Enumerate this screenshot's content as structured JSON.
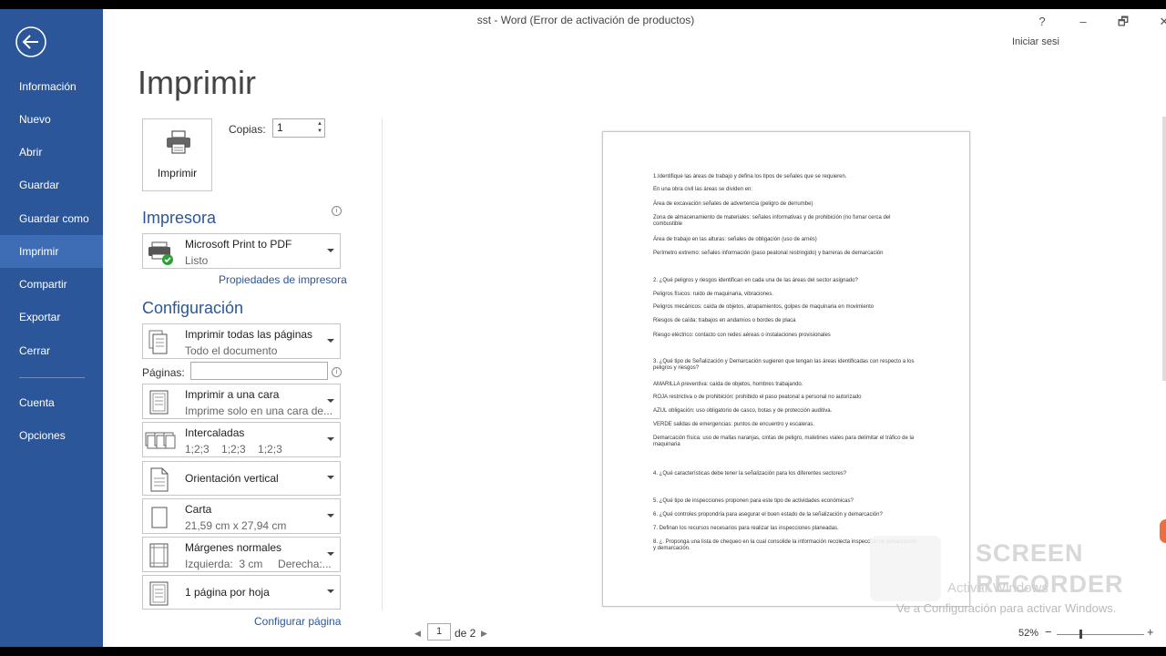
{
  "window": {
    "title": "sst - Word (Error de activación de productos)",
    "help": "?",
    "minimize": "–",
    "restore": "🗗",
    "close": "✕",
    "signin": "Iniciar sesi"
  },
  "sidebar": {
    "items": [
      {
        "label": "Información"
      },
      {
        "label": "Nuevo"
      },
      {
        "label": "Abrir"
      },
      {
        "label": "Guardar"
      },
      {
        "label": "Guardar como"
      },
      {
        "label": "Imprimir",
        "active": true
      },
      {
        "label": "Compartir"
      },
      {
        "label": "Exportar"
      },
      {
        "label": "Cerrar"
      },
      {
        "label": "Cuenta"
      },
      {
        "label": "Opciones"
      }
    ]
  },
  "print": {
    "page_title": "Imprimir",
    "print_button": "Imprimir",
    "copies_label": "Copias:",
    "copies_value": "1",
    "printer_heading": "Impresora",
    "printer_name": "Microsoft Print to PDF",
    "printer_status": "Listo",
    "printer_properties": "Propiedades de impresora",
    "config_heading": "Configuración",
    "pages_label": "Páginas:",
    "pages_value": "",
    "settings": [
      {
        "main": "Imprimir todas las páginas",
        "sub": "Todo el documento"
      },
      {
        "main": "Imprimir a una cara",
        "sub": "Imprime solo en una cara de..."
      },
      {
        "main": "Intercaladas",
        "sub": "1;2;3    1;2;3    1;2;3"
      },
      {
        "main": "Orientación vertical",
        "sub": ""
      },
      {
        "main": "Carta",
        "sub": "21,59 cm x 27,94 cm"
      },
      {
        "main": "Márgenes normales",
        "sub": "Izquierda:  3 cm     Derecha:..."
      },
      {
        "main": "1 página por hoja",
        "sub": ""
      }
    ],
    "page_setup": "Configurar página"
  },
  "preview": {
    "lines": [
      "1.Identifique las áreas de trabajo y defina los tipos de señales que se requieren.",
      "En una obra civil las áreas se dividen en:",
      "Área de excavación señales de advertencia (peligro de derrumbe)",
      "Zona de almacenamiento de materiales: señales informativas y de prohibición (no fumar cerca del combustible",
      "Área de trabajo en las alturas: señales de obligación (uso de arnés)",
      "Perímetro extremo: señales información (paso peatonal restringido) y  barreras de demarcación",
      "2. ¿Qué peligros y riesgos identifican en cada una de las áreas del sector asignado?",
      "Peligros físicos: ruido de maquinaria, vibraciones.",
      "Peligros mecánicos: caída de objetos, atrapamientos, golpes de maquinaria en movimiento",
      "Riesgos de caída: trabajos en andamios o bordes de placa",
      "Riesgo eléctrico:  contacto con redes aéreas o instalaciones provisionales",
      "3. ¿Qué tipo de Señalización y Demarcación sugieren que tengan las áreas identificadas con respecto a los peligros y riesgos?",
      "AMARILLA preventiva: caída de objetos, hombres trabajando.",
      "ROJA restrictiva o de prohibición: prohibido el paso peatonal a personal no autorizado",
      "AZUL obligación: uso obligatorio de casco, botas y de protección auditiva.",
      "VERDE salidas de emergencias: puntos de encuentro y escaleras.",
      "Demarcación física: uso de mallas naranjas, cintas de peligro, maletines viales para delimitar el tráfico de la maquinaria",
      "4. ¿Qué características debe tener la señalización para los diferentes sectores?",
      "5. ¿Qué tipo de inspecciones proponen para este tipo de actividades económicas?",
      "6. ¿Qué controles propondría para asegurar el buen estado de la señalización y demarcación?",
      "7. Definan los recursos necesarios para realizar las inspecciones planeadas.",
      "8. ¿. Proponga una lista de chequeo en la cual consolide la información recolecta inspección de señalización y demarcación."
    ],
    "page_current": "1",
    "page_of": "de 2",
    "zoom": "52%"
  },
  "overlay": {
    "activate_title": "Activar Windows",
    "activate_msg": "Ve a Configuración para activar Windows.",
    "recorder_line1": "SCREEN",
    "recorder_line2": "RECORDER"
  }
}
